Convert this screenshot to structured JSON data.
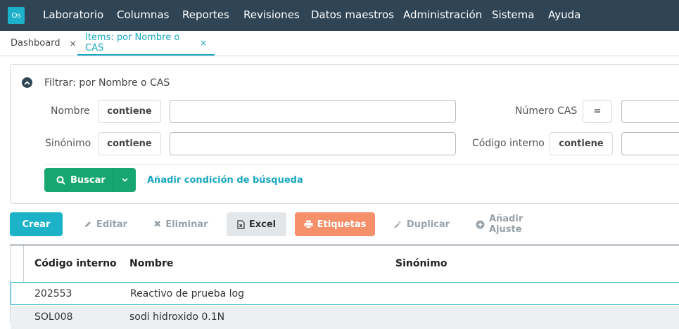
{
  "app": {
    "logo_text": "Os",
    "menu": [
      "Laboratorio",
      "Columnas",
      "Reportes",
      "Revisiones",
      "Datos maestros",
      "Administración",
      "Sistema",
      "Ayuda"
    ]
  },
  "tabs": [
    {
      "label": "Dashboard",
      "close": "×"
    },
    {
      "label": "Items: por Nombre o CAS",
      "close": "×"
    }
  ],
  "filter": {
    "title": "Filtrar: por Nombre o CAS",
    "fields": [
      {
        "label": "Nombre",
        "operator": "contiene",
        "value": ""
      },
      {
        "label": "Número CAS",
        "operator": "=",
        "value": ""
      },
      {
        "label": "Sinónimo",
        "operator": "contiene",
        "value": ""
      },
      {
        "label": "Código interno",
        "operator": "contiene",
        "value": ""
      }
    ],
    "search_label": "Buscar",
    "add_condition_label": "Añadir condición de búsqueda"
  },
  "toolbar": {
    "create": "Crear",
    "edit": "Editar",
    "delete": "Eliminar",
    "excel": "Excel",
    "labels": "Etiquetas",
    "duplicate": "Duplicar",
    "add_adjust": "Añadir Ajuste"
  },
  "table": {
    "columns": [
      "Código interno",
      "Nombre",
      "Sinónimo"
    ],
    "rows": [
      [
        "202553",
        "Reactivo de prueba log",
        ""
      ],
      [
        "SOL008",
        "sodi hidroxido 0.1N",
        ""
      ]
    ]
  },
  "colors": {
    "topbar": "#2f4454",
    "accent": "#1cb3c9",
    "search": "#17a672",
    "labels": "#f5906a"
  }
}
